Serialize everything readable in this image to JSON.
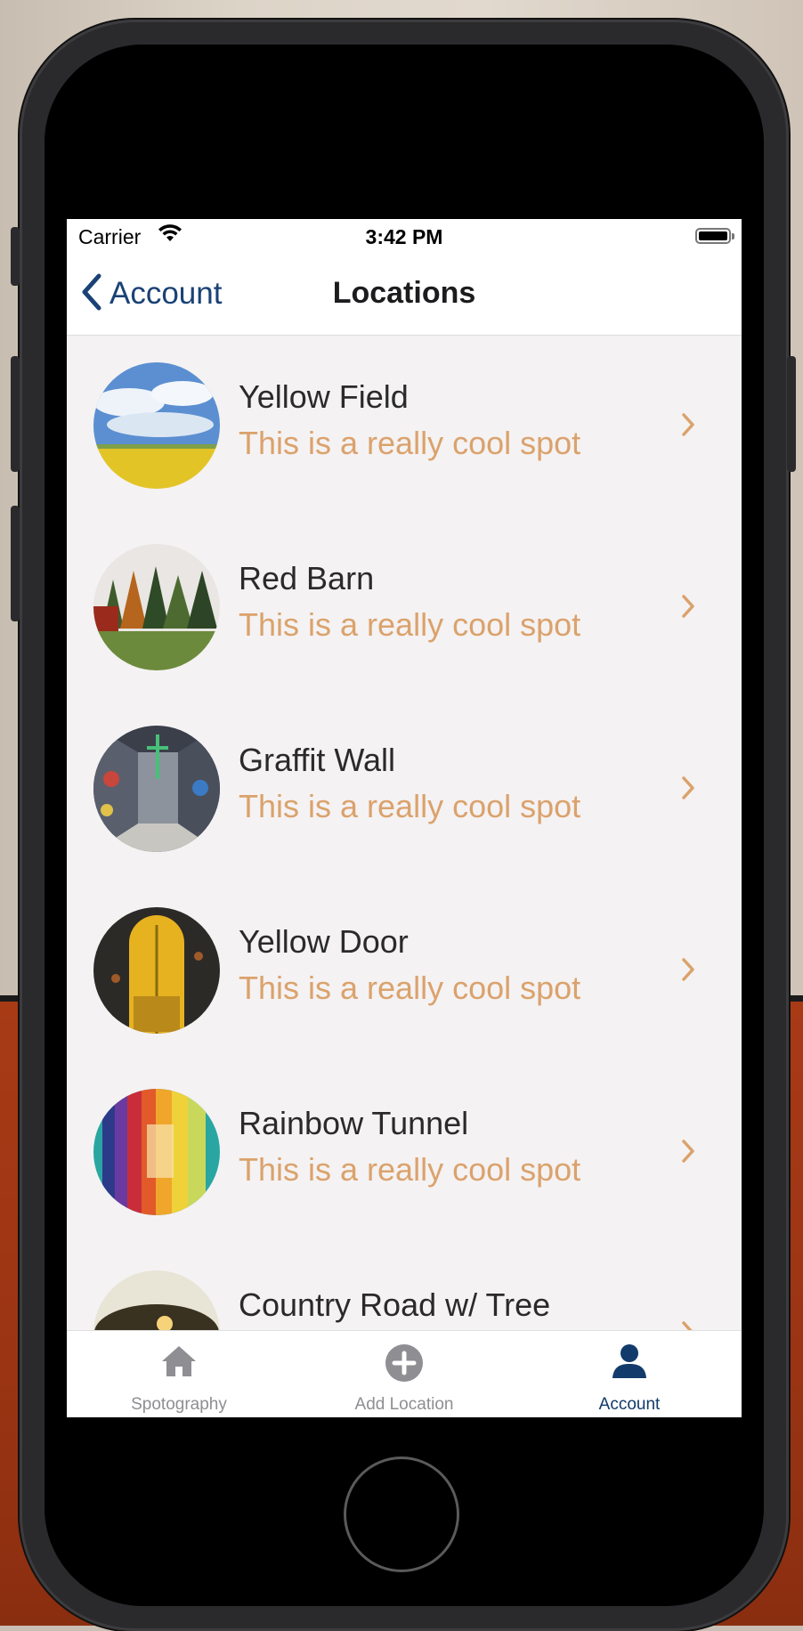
{
  "status_bar": {
    "carrier": "Carrier",
    "time": "3:42 PM"
  },
  "nav": {
    "back_label": "Account",
    "title": "Locations"
  },
  "locations": [
    {
      "title": "Yellow Field",
      "subtitle": "This is a really cool spot"
    },
    {
      "title": "Red Barn",
      "subtitle": "This is a really cool spot"
    },
    {
      "title": "Graffit Wall",
      "subtitle": "This is a really cool spot"
    },
    {
      "title": "Yellow Door",
      "subtitle": "This is a really cool spot"
    },
    {
      "title": "Rainbow Tunnel",
      "subtitle": "This is a really cool spot"
    },
    {
      "title": "Country Road w/ Tree",
      "subtitle": ""
    }
  ],
  "tabs": [
    {
      "label": "Spotography",
      "icon": "home-icon"
    },
    {
      "label": "Add Location",
      "icon": "plus-circle-icon"
    },
    {
      "label": "Account",
      "icon": "person-icon",
      "active": true
    }
  ],
  "colors": {
    "accent": "#1a4275",
    "subtitle": "#dba26c",
    "chevron": "#dba26c",
    "list_bg": "#f4f2f3"
  }
}
